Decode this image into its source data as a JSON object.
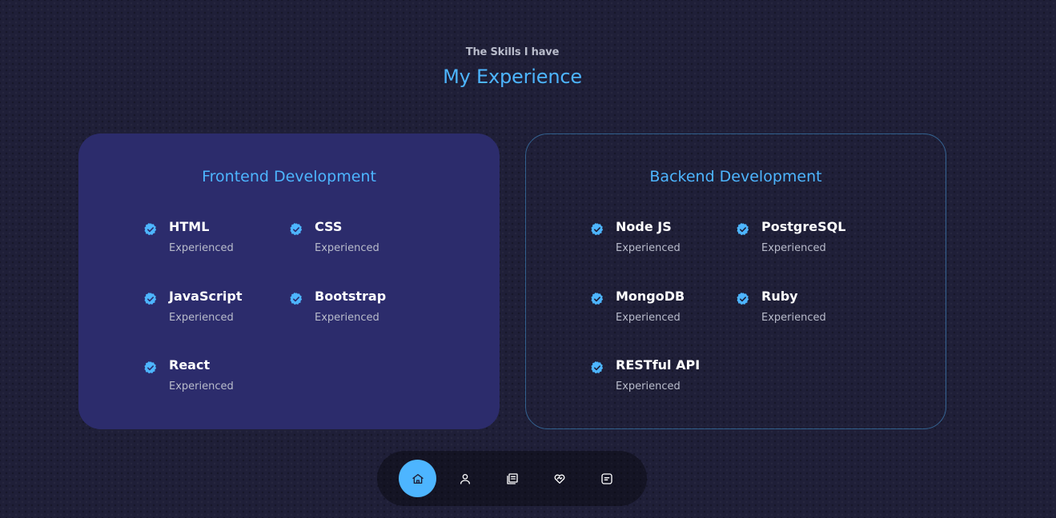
{
  "header": {
    "subtitle": "The Skills I have",
    "title": "My Experience"
  },
  "frontend": {
    "title": "Frontend Development",
    "skills": [
      {
        "name": "HTML",
        "level": "Experienced"
      },
      {
        "name": "CSS",
        "level": "Experienced"
      },
      {
        "name": "JavaScript",
        "level": "Experienced"
      },
      {
        "name": "Bootstrap",
        "level": "Experienced"
      },
      {
        "name": "React",
        "level": "Experienced"
      }
    ]
  },
  "backend": {
    "title": "Backend Development",
    "skills": [
      {
        "name": "Node JS",
        "level": "Experienced"
      },
      {
        "name": "PostgreSQL",
        "level": "Experienced"
      },
      {
        "name": "MongoDB",
        "level": "Experienced"
      },
      {
        "name": "Ruby",
        "level": "Experienced"
      },
      {
        "name": "RESTful API",
        "level": "Experienced"
      }
    ]
  },
  "nav": {
    "items": [
      {
        "icon": "home-icon",
        "active": true
      },
      {
        "icon": "user-icon",
        "active": false
      },
      {
        "icon": "book-icon",
        "active": false
      },
      {
        "icon": "services-icon",
        "active": false
      },
      {
        "icon": "message-icon",
        "active": false
      }
    ]
  },
  "colors": {
    "accent": "#4db5ff",
    "card_background": "#2c2c6c",
    "page_background": "#1f1f38"
  }
}
